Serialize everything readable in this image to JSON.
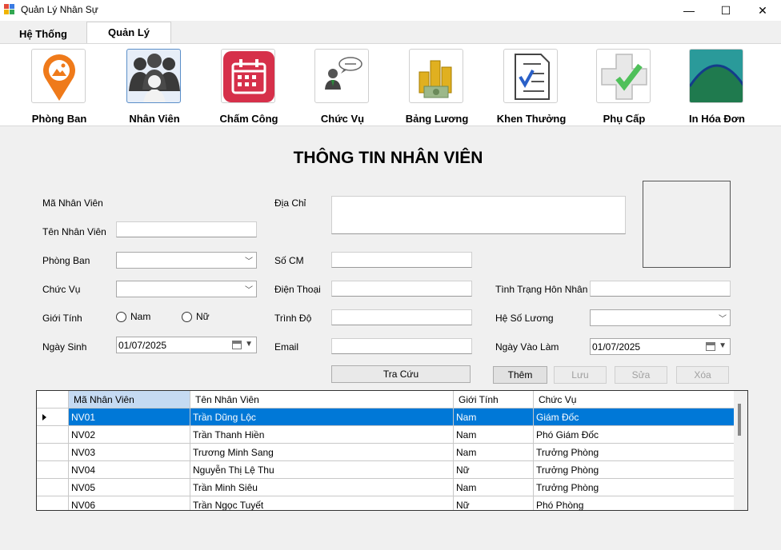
{
  "window": {
    "title": "Quản Lý Nhân Sự",
    "minimize": "—",
    "maximize": "☐",
    "close": "✕"
  },
  "tabs": [
    {
      "label": "Hệ Thống"
    },
    {
      "label": "Quản Lý"
    }
  ],
  "ribbon": [
    {
      "label": "Phòng Ban",
      "icon": "location-pin-icon"
    },
    {
      "label": "Nhân Viên",
      "icon": "people-icon"
    },
    {
      "label": "Chấm Công",
      "icon": "calendar-icon"
    },
    {
      "label": "Chức Vụ",
      "icon": "speaker-icon"
    },
    {
      "label": "Bảng Lương",
      "icon": "coins-icon"
    },
    {
      "label": "Khen Thưởng",
      "icon": "checklist-icon"
    },
    {
      "label": "Phụ Cấp",
      "icon": "medical-cross-icon"
    },
    {
      "label": "In Hóa Đơn",
      "icon": "mountain-icon"
    }
  ],
  "heading": "THÔNG TIN NHÂN VIÊN",
  "form": {
    "ma_nv_label": "Mã Nhân Viên",
    "ten_nv_label": "Tên Nhân Viên",
    "phong_ban_label": "Phòng Ban",
    "chuc_vu_label": "Chức Vụ",
    "gioi_tinh_label": "Giới Tính",
    "nam_label": "Nam",
    "nu_label": "Nữ",
    "ngay_sinh_label": "Ngày Sinh",
    "ngay_sinh_value": "01/07/2025",
    "dia_chi_label": "Địa Chỉ",
    "so_cm_label": "Số CM",
    "dien_thoai_label": "Điện Thoại",
    "trinh_do_label": "Trình Độ",
    "email_label": "Email",
    "hon_nhan_label": "Tình Trạng Hôn Nhân",
    "he_so_luong_label": "Hệ Số Lương",
    "ngay_vao_lam_label": "Ngày Vào Làm",
    "ngay_vao_lam_value": "01/07/2025"
  },
  "buttons": {
    "tra_cuu": "Tra Cứu",
    "them": "Thêm",
    "luu": "Lưu",
    "sua": "Sửa",
    "xoa": "Xóa"
  },
  "grid": {
    "columns": [
      "Mã Nhân Viên",
      "Tên Nhân Viên",
      "Giới Tính",
      "Chức Vụ"
    ],
    "rows": [
      [
        "NV01",
        "Trần Dũng Lộc",
        "Nam",
        "Giám Đốc"
      ],
      [
        "NV02",
        "Trần Thanh Hiền",
        "Nam",
        "Phó Giám Đốc"
      ],
      [
        "NV03",
        "Trương Minh Sang",
        "Nam",
        "Trưởng Phòng"
      ],
      [
        "NV04",
        "Nguyễn Thị Lệ Thu",
        "Nữ",
        "Trưởng Phòng"
      ],
      [
        "NV05",
        "Trần Minh Siêu",
        "Nam",
        "Trưởng Phòng"
      ],
      [
        "NV06",
        "Trần Ngọc Tuyết",
        "Nữ",
        "Phó Phòng"
      ]
    ]
  },
  "colors": {
    "selection": "#0078d7",
    "header_selected": "#c5daf2"
  }
}
